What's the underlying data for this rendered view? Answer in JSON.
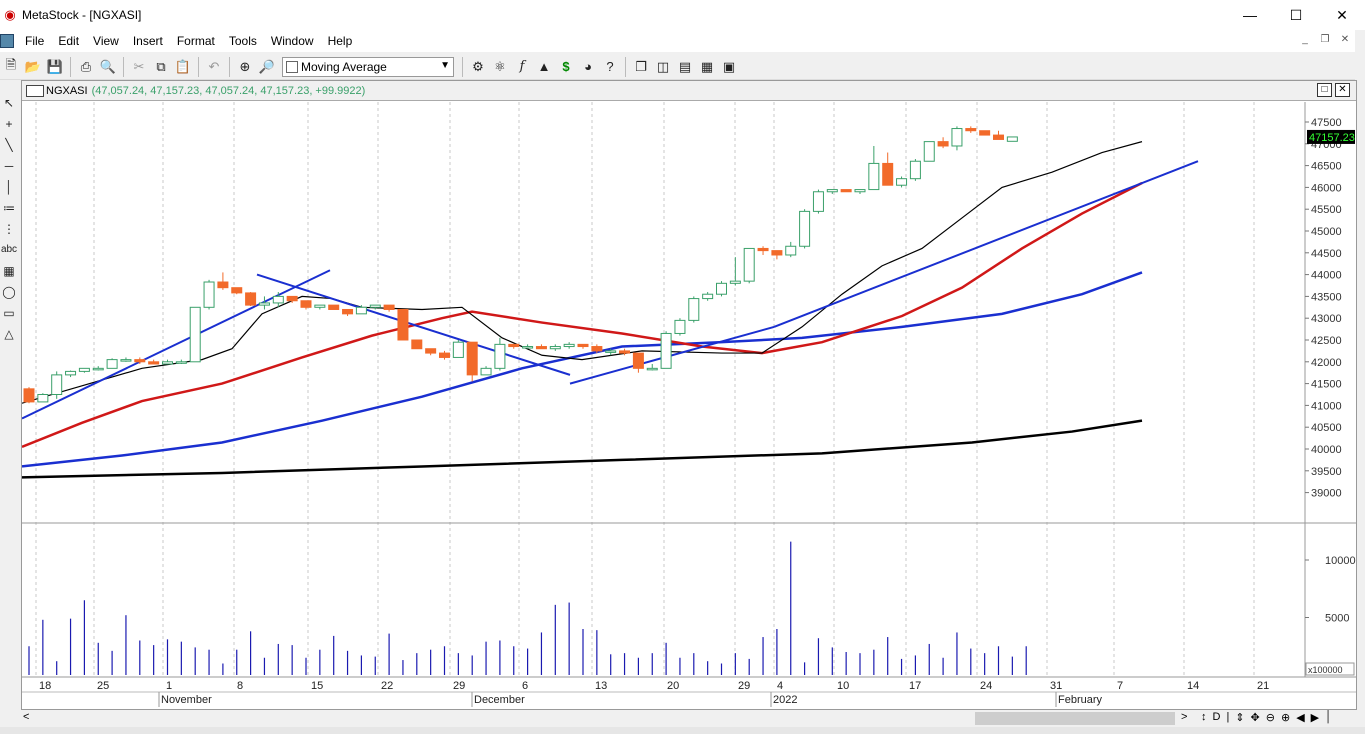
{
  "window": {
    "title": "MetaStock - [NGXASI]",
    "controls": [
      "—",
      "☐",
      "✕"
    ]
  },
  "menu": [
    "File",
    "Edit",
    "View",
    "Insert",
    "Format",
    "Tools",
    "Window",
    "Help"
  ],
  "mdi_controls": [
    "_",
    "❐",
    "✕"
  ],
  "toolbar": {
    "indicator_select": "Moving Average"
  },
  "chart": {
    "symbol": "NGXASI",
    "values": "(47,057.24, 47,157.23, 47,057.24, 47,157.23, +99.9922)",
    "last_price": "47157.23",
    "volume_scale_label": "x100000",
    "price_ticks": [
      39000,
      39500,
      40000,
      40500,
      41000,
      41500,
      42000,
      42500,
      43000,
      43500,
      44000,
      44500,
      45000,
      45500,
      46000,
      46500,
      47000,
      47500
    ],
    "volume_ticks": [
      5000,
      10000
    ],
    "date_ticks": [
      "18",
      "25",
      "1",
      "8",
      "15",
      "22",
      "29",
      "6",
      "13",
      "20",
      "29",
      "4",
      "10",
      "17",
      "24",
      "31",
      "7",
      "14",
      "21"
    ],
    "months": [
      "November",
      "December",
      "2022",
      "February"
    ],
    "up_color": "#3aa06a",
    "down_color": "#f26a2a",
    "candles": [
      [
        41380,
        41420,
        41050,
        41080
      ],
      [
        41080,
        41280,
        41100,
        41250
      ],
      [
        41250,
        41780,
        41150,
        41700
      ],
      [
        41700,
        41800,
        41650,
        41780
      ],
      [
        41780,
        41850,
        41750,
        41850
      ],
      [
        41850,
        41900,
        41800,
        41850
      ],
      [
        41850,
        42080,
        41850,
        42050
      ],
      [
        42050,
        42100,
        42000,
        42050
      ],
      [
        42050,
        42100,
        41950,
        42000
      ],
      [
        42000,
        42050,
        41950,
        41950
      ],
      [
        41950,
        42050,
        41950,
        42000
      ],
      [
        42000,
        42050,
        41950,
        42000
      ],
      [
        42000,
        43250,
        42000,
        43250
      ],
      [
        43250,
        43880,
        43200,
        43830
      ],
      [
        43830,
        44050,
        43650,
        43700
      ],
      [
        43700,
        43700,
        43550,
        43580
      ],
      [
        43580,
        43600,
        43280,
        43300
      ],
      [
        43300,
        43500,
        43200,
        43350
      ],
      [
        43350,
        43600,
        43250,
        43500
      ],
      [
        43500,
        43500,
        43350,
        43400
      ],
      [
        43400,
        43400,
        43200,
        43250
      ],
      [
        43250,
        43300,
        43200,
        43300
      ],
      [
        43300,
        43300,
        43200,
        43200
      ],
      [
        43200,
        43200,
        43050,
        43100
      ],
      [
        43100,
        43300,
        43100,
        43250
      ],
      [
        43250,
        43300,
        43200,
        43300
      ],
      [
        43300,
        43300,
        43150,
        43200
      ],
      [
        43200,
        43200,
        42500,
        42500
      ],
      [
        42500,
        42500,
        42300,
        42300
      ],
      [
        42300,
        42300,
        42150,
        42200
      ],
      [
        42200,
        42250,
        42050,
        42100
      ],
      [
        42100,
        42500,
        42100,
        42450
      ],
      [
        42450,
        42450,
        41550,
        41700
      ],
      [
        41700,
        41900,
        41700,
        41850
      ],
      [
        41850,
        42550,
        41800,
        42400
      ],
      [
        42400,
        42400,
        42300,
        42350
      ],
      [
        42350,
        42400,
        42300,
        42350
      ],
      [
        42350,
        42400,
        42300,
        42300
      ],
      [
        42300,
        42400,
        42250,
        42350
      ],
      [
        42350,
        42450,
        42300,
        42400
      ],
      [
        42400,
        42400,
        42300,
        42350
      ],
      [
        42350,
        42400,
        42200,
        42250
      ],
      [
        42250,
        42300,
        42150,
        42250
      ],
      [
        42250,
        42300,
        42150,
        42200
      ],
      [
        42200,
        42200,
        41750,
        41850
      ],
      [
        41850,
        41950,
        41800,
        41850
      ],
      [
        41850,
        42700,
        41850,
        42650
      ],
      [
        42650,
        43000,
        42600,
        42950
      ],
      [
        42950,
        43500,
        42900,
        43450
      ],
      [
        43450,
        43600,
        43400,
        43550
      ],
      [
        43550,
        43850,
        43500,
        43800
      ],
      [
        43800,
        44400,
        43750,
        43850
      ],
      [
        43850,
        44600,
        43800,
        44600
      ],
      [
        44600,
        44650,
        44450,
        44550
      ],
      [
        44550,
        44550,
        44350,
        44450
      ],
      [
        44450,
        44750,
        44400,
        44650
      ],
      [
        44650,
        45500,
        44600,
        45450
      ],
      [
        45450,
        45950,
        45400,
        45900
      ],
      [
        45900,
        45950,
        45850,
        45950
      ],
      [
        45950,
        45950,
        45900,
        45900
      ],
      [
        45900,
        45950,
        45850,
        45950
      ],
      [
        45950,
        46950,
        45950,
        46550
      ],
      [
        46550,
        46800,
        46050,
        46050
      ],
      [
        46050,
        46250,
        46000,
        46200
      ],
      [
        46200,
        46650,
        46150,
        46600
      ],
      [
        46600,
        47050,
        46600,
        47050
      ],
      [
        47050,
        47150,
        46900,
        46950
      ],
      [
        46950,
        47400,
        46850,
        47350
      ],
      [
        47350,
        47400,
        47250,
        47300
      ],
      [
        47300,
        47300,
        47200,
        47200
      ],
      [
        47200,
        47300,
        47100,
        47100
      ],
      [
        47057.24,
        47157.23,
        47057.24,
        47157.23
      ]
    ],
    "volume": [
      2.5,
      4.8,
      1.2,
      4.9,
      6.5,
      2.8,
      2.1,
      5.2,
      3.0,
      2.6,
      3.1,
      2.9,
      2.4,
      2.2,
      1.0,
      2.2,
      3.8,
      1.5,
      2.7,
      2.6,
      1.5,
      2.2,
      3.4,
      2.1,
      1.7,
      1.6,
      3.6,
      1.3,
      1.9,
      2.2,
      2.5,
      1.9,
      1.7,
      2.9,
      3.0,
      2.5,
      2.3,
      3.7,
      6.1,
      6.3,
      4.0,
      3.9,
      1.8,
      1.9,
      1.5,
      1.9,
      2.8,
      1.5,
      1.9,
      1.2,
      1.0,
      1.9,
      1.4,
      3.3,
      4.0,
      11.6,
      1.1,
      3.2,
      2.4,
      2.0,
      1.9,
      2.2,
      3.3,
      1.4,
      1.7,
      2.7,
      1.5,
      3.7,
      2.3,
      1.9,
      2.5,
      1.6,
      2.5
    ]
  }
}
